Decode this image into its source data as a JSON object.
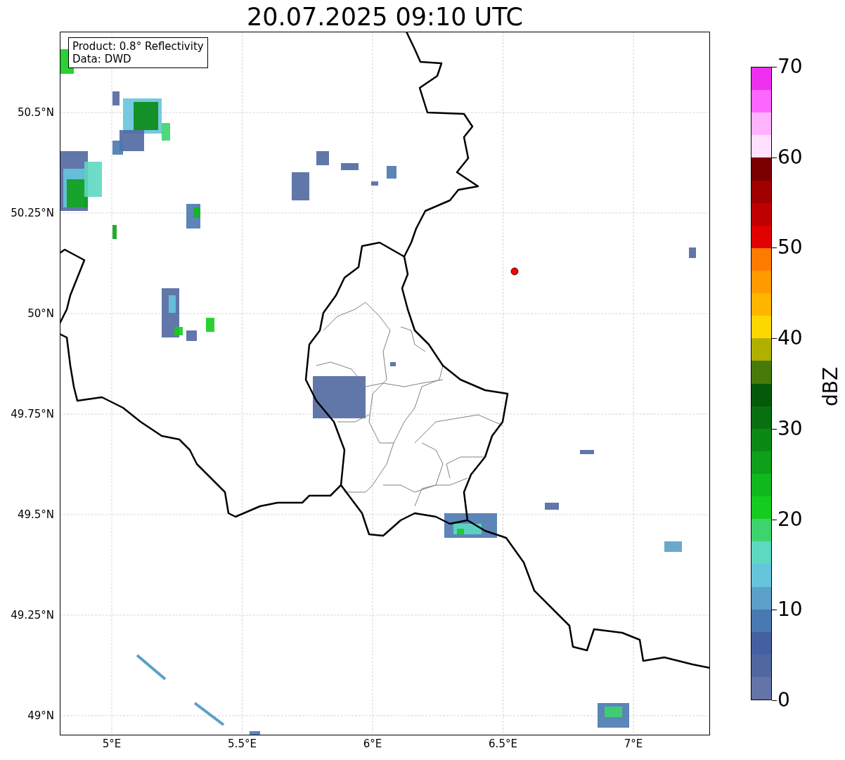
{
  "title": "20.07.2025 09:10 UTC",
  "legend": [
    "Product: 0.8° Reflectivity",
    "Data: DWD"
  ],
  "map": {
    "yticks": [
      "50.5°N",
      "50.25°N",
      "50°N",
      "49.75°N",
      "49.5°N",
      "49.25°N",
      "49°N"
    ],
    "xticks": [
      "5°E",
      "5.5°E",
      "6°E",
      "6.5°E",
      "7°E"
    ]
  },
  "colorbar": {
    "label": "dBZ",
    "ticks": [
      "70",
      "60",
      "50",
      "40",
      "30",
      "20",
      "10",
      "0"
    ],
    "segments": [
      {
        "color": "#ee30ee"
      },
      {
        "color": "#ff66ff"
      },
      {
        "color": "#ffb3ff"
      },
      {
        "color": "#ffe0ff"
      },
      {
        "color": "#7a0000"
      },
      {
        "color": "#a00000"
      },
      {
        "color": "#c00000"
      },
      {
        "color": "#e00000"
      },
      {
        "color": "#ff7b00"
      },
      {
        "color": "#ff9a00"
      },
      {
        "color": "#ffb400"
      },
      {
        "color": "#ffd700"
      },
      {
        "color": "#b0b000"
      },
      {
        "color": "#467a0a"
      },
      {
        "color": "#055a0a"
      },
      {
        "color": "#0a700f"
      },
      {
        "color": "#0a8a14"
      },
      {
        "color": "#0ea01a"
      },
      {
        "color": "#10b81e"
      },
      {
        "color": "#14cc1e"
      },
      {
        "color": "#3dd46e"
      },
      {
        "color": "#5ed8c0"
      },
      {
        "color": "#66c4dc"
      },
      {
        "color": "#5aa0c8"
      },
      {
        "color": "#4a78b0"
      },
      {
        "color": "#4460a0"
      },
      {
        "color": "#5068a0"
      },
      {
        "color": "#6474a8"
      }
    ]
  }
}
